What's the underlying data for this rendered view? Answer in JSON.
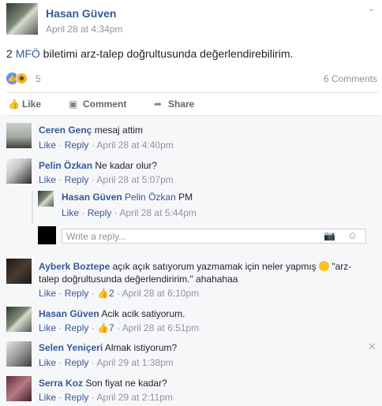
{
  "post": {
    "author": "Hasan Güven",
    "timestamp": "April 28 at 4:34pm",
    "text_prefix": "2 ",
    "text_link": "MFÖ",
    "text_suffix": " biletimi arz-talep doğrultusunda değerlendirebilirim.",
    "reaction_count": "5",
    "comments_count": "6 Comments",
    "actions": {
      "like": "Like",
      "comment": "Comment",
      "share": "Share"
    }
  },
  "comments": [
    {
      "author": "Ceren Genç",
      "text": "mesaj attim",
      "like": "Like",
      "reply": "Reply",
      "time": "April 28 at 4:40pm"
    },
    {
      "author": "Pelin Özkan",
      "text": "Ne kadar olur?",
      "like": "Like",
      "reply": "Reply",
      "time": "April 28 at 5:07pm"
    },
    {
      "author": "Ayberk Boztepe",
      "text_line1": "açık açık satıyorum yazmamak için neler yapmış",
      "text_line1_end": "\"arz-",
      "text_line2": "talep doğrultusunda değerlendiririm.\" ahahahaa",
      "like": "Like",
      "reply": "Reply",
      "likes": "2",
      "time": "April 28 at 6:10pm"
    },
    {
      "author": "Hasan Güven",
      "text": "Acik acik satiyorum.",
      "like": "Like",
      "reply": "Reply",
      "likes": "7",
      "time": "April 28 at 6:51pm"
    },
    {
      "author": "Selen Yeniçeri",
      "text": "Almak istiyorum?",
      "like": "Like",
      "reply": "Reply",
      "time": "April 29 at 1:38pm"
    },
    {
      "author": "Serra Koz",
      "text": "Son fiyat ne kadar?",
      "like": "Like",
      "reply": "Reply",
      "time": "April 29 at 2:11pm"
    }
  ],
  "reply": {
    "author": "Hasan Güven",
    "mention": "Pelin Özkan",
    "text": "PM",
    "like": "Like",
    "reply": "Reply",
    "time": "April 28 at 5:44pm"
  },
  "reply_input": {
    "placeholder": "Write a reply..."
  },
  "icons": {
    "chevron": "chevron-down-icon",
    "like": "thumbs-up-icon",
    "comment": "comment-bubble-icon",
    "share": "share-arrow-icon",
    "camera": "camera-icon",
    "emoji": "smiley-icon",
    "close": "close-icon"
  },
  "colors": {
    "link": "#365899",
    "meta": "#90949c",
    "like_reaction": "#5890ff",
    "haha_reaction": "#f7b125",
    "comments_bg": "#f6f7f9"
  }
}
